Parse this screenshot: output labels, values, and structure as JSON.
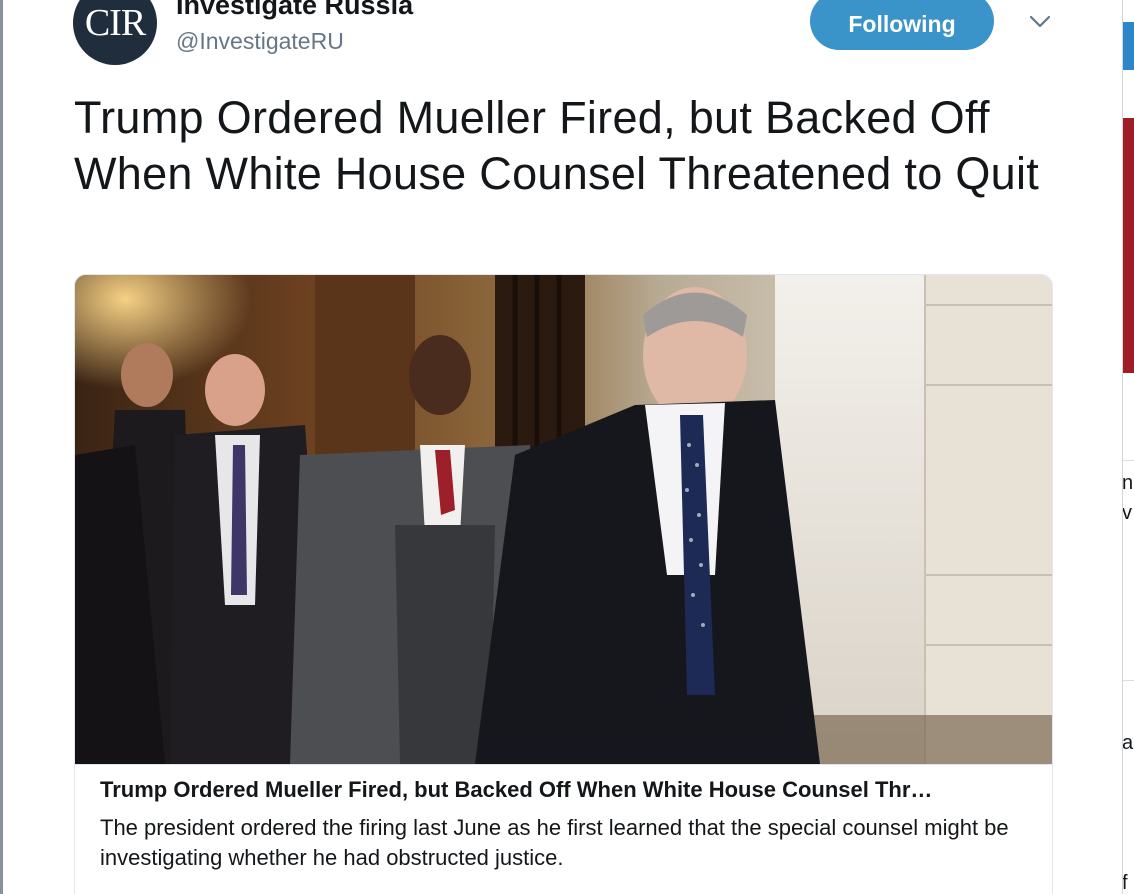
{
  "tweet": {
    "avatar_text": "CIR",
    "display_name": "Investigate Russia",
    "handle": "@InvestigateRU",
    "follow_button_label": "Following",
    "headline": "Trump Ordered Mueller Fired, but Backed Off When White House Counsel Threatened to Quit"
  },
  "card": {
    "title": "Trump Ordered Mueller Fired, but Backed Off When White House Counsel Thr…",
    "description": "The president ordered the firing last June as he first learned that the special counsel might be investigating whether he had obstructed justice."
  },
  "background_page": {
    "right_edge_fragments": [
      "n",
      "v",
      "a",
      "f"
    ]
  },
  "icons": {
    "caret": "chevron-down-icon"
  },
  "colors": {
    "follow_button": "#3a94c9",
    "text_primary": "#14171a",
    "text_secondary": "#657786",
    "avatar_bg": "#1f2d3d"
  }
}
